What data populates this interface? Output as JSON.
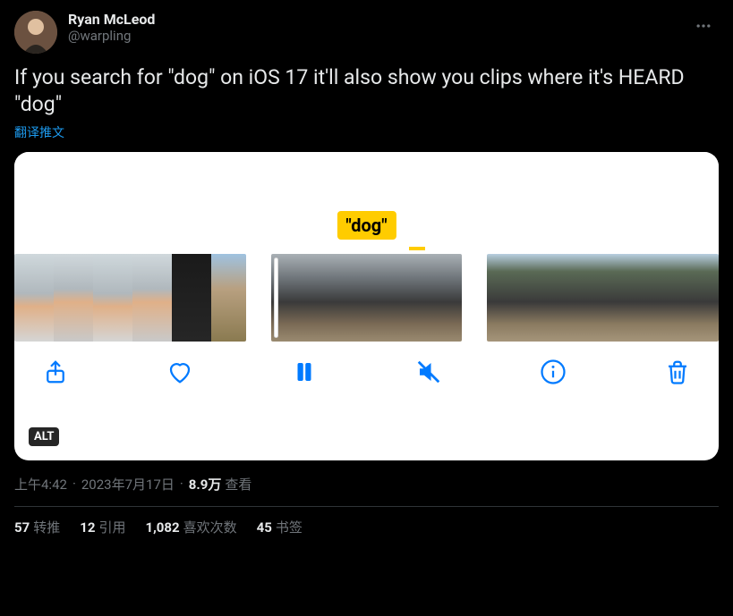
{
  "author": {
    "display_name": "Ryan McLeod",
    "handle": "@warpling"
  },
  "tweet_text": "If you search for \"dog\" on iOS 17 it'll also show you clips where it's HEARD \"dog\"",
  "translate_label": "翻译推文",
  "media": {
    "search_term_badge": "\"dog\"",
    "alt_badge": "ALT"
  },
  "meta": {
    "time": "上午4:42",
    "date": "2023年7月17日",
    "views_count": "8.9万",
    "views_label": "查看"
  },
  "stats": {
    "retweets": {
      "count": "57",
      "label": "转推"
    },
    "quotes": {
      "count": "12",
      "label": "引用"
    },
    "likes": {
      "count": "1,082",
      "label": "喜欢次数"
    },
    "bookmarks": {
      "count": "45",
      "label": "书签"
    }
  }
}
